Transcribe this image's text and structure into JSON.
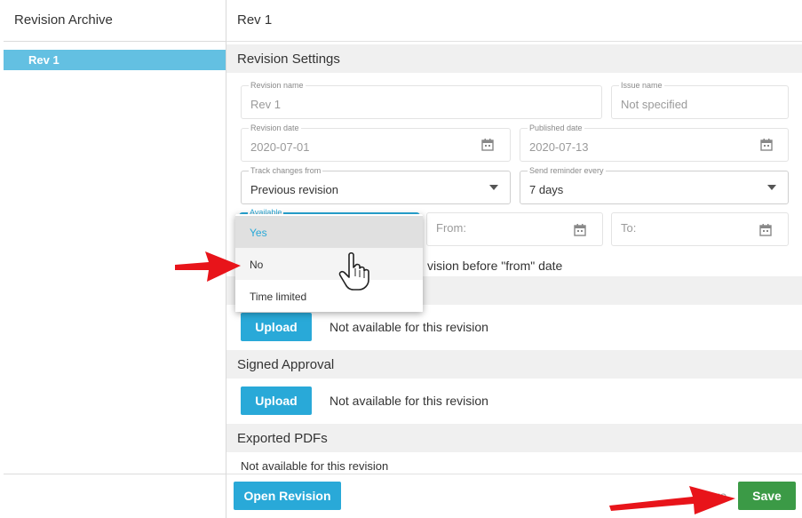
{
  "sidebar": {
    "title": "Revision Archive",
    "items": [
      {
        "label": "Rev 1",
        "selected": true
      }
    ]
  },
  "main": {
    "title": "Rev 1",
    "sections": {
      "revision_settings": "Revision Settings",
      "signed_approval": "Signed Approval",
      "exported_pdfs": "Exported PDFs"
    },
    "fields": {
      "revision_name": {
        "label": "Revision name",
        "value": "Rev 1"
      },
      "issue_name": {
        "label": "Issue name",
        "placeholder": "Not specified"
      },
      "revision_date": {
        "label": "Revision date",
        "value": "2020-07-01"
      },
      "published_date": {
        "label": "Published date",
        "value": "2020-07-13"
      },
      "track_changes": {
        "label": "Track changes from",
        "value": "Previous revision"
      },
      "send_reminder": {
        "label": "Send reminder every",
        "value": "7 days"
      },
      "available": {
        "label": "Available"
      },
      "from": {
        "placeholder": "From:"
      },
      "to": {
        "placeholder": "To:"
      }
    },
    "partial_text": "vision before \"from\" date",
    "upload_label": "Upload",
    "not_available": "Not available for this revision"
  },
  "dropdown": {
    "options": [
      "Yes",
      "No",
      "Time limited"
    ],
    "selected": "Yes",
    "hovered": "No"
  },
  "footer": {
    "open_revision": "Open Revision",
    "partial_hidden": "ore",
    "save": "Save"
  },
  "colors": {
    "accent": "#29a9d8",
    "sidebar_selected": "#63c0e2",
    "save": "#3b9a46",
    "annotation_arrow": "#e8141a"
  }
}
